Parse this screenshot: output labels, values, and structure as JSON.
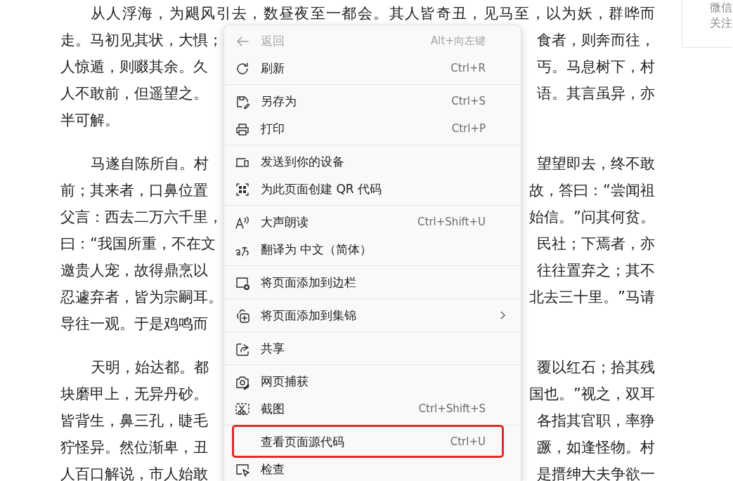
{
  "article": {
    "paragraphs": [
      {
        "lines": [
          {
            "left": "从人浮海，为飓风引去，数昼夜至一都会。其人皆奇丑，见马至，以为妖，群哗而"
          },
          {
            "left": "走。马初见其状，大惧；",
            "right": "食者，则奔而往，"
          },
          {
            "left": "人惊遁，则啜其余。久",
            "right": "丐。马息树下，村"
          },
          {
            "left": "人不敢前，但遥望之。",
            "right": "语。其言虽异，亦"
          },
          {
            "left": "半可解。"
          }
        ]
      },
      {
        "lines": [
          {
            "left": "马遂自陈所自。村",
            "right": "望望即去，终不敢"
          },
          {
            "left": "前；其来者，口鼻位置",
            "right": "故，答曰：“尝闻祖"
          },
          {
            "left": "父言：西去二万六千里，",
            "right": "始信。”问其何贫。"
          },
          {
            "left": "曰：“我国所重，不在文",
            "right": "民社；下焉者，亦"
          },
          {
            "left": "邀贵人宠，故得鼎烹以",
            "right": "往往置弃之；其不"
          },
          {
            "left": "忍遽弃者，皆为宗嗣耳。",
            "right": "北去三十里。”马请"
          },
          {
            "left": "导往一观。于是鸡鸣而"
          }
        ]
      },
      {
        "lines": [
          {
            "left": "天明，始达都。都",
            "right": "覆以红石；拾其残"
          },
          {
            "left": "块磨甲上，无异丹砂。",
            "right": "国也。”视之，双耳"
          },
          {
            "left": "皆背生，鼻三孔，睫毛",
            "right": "各指其官职，率狰"
          },
          {
            "left": "狞怪异。然位渐卑，丑",
            "right": "蹶，如逢怪物。村"
          },
          {
            "left": "人百口解说，市人始敢",
            "right": "是搢绅大夫争欲一"
          }
        ]
      }
    ]
  },
  "side_card": {
    "lines": [
      "微信",
      "关注"
    ]
  },
  "context_menu": {
    "groups": [
      [
        {
          "label": "返回",
          "shortcut": "Alt+向左键",
          "disabled": true
        },
        {
          "label": "刷新",
          "shortcut": "Ctrl+R",
          "disabled": false
        }
      ],
      [
        {
          "label": "另存为",
          "shortcut": "Ctrl+S",
          "disabled": false
        },
        {
          "label": "打印",
          "shortcut": "Ctrl+P",
          "disabled": false
        }
      ],
      [
        {
          "label": "发送到你的设备",
          "disabled": false
        },
        {
          "label": "为此页面创建 QR 代码",
          "disabled": false
        }
      ],
      [
        {
          "label": "大声朗读",
          "shortcut": "Ctrl+Shift+U",
          "disabled": false
        },
        {
          "label": "翻译为 中文（简体）",
          "disabled": false
        }
      ],
      [
        {
          "label": "将页面添加到边栏",
          "disabled": false
        }
      ],
      [
        {
          "label": "将页面添加到集锦",
          "disabled": false,
          "submenu": true
        }
      ],
      [
        {
          "label": "共享",
          "disabled": false
        }
      ],
      [
        {
          "label": "网页捕获",
          "disabled": false
        },
        {
          "label": "截图",
          "shortcut": "Ctrl+Shift+S",
          "disabled": false
        }
      ],
      [
        {
          "label": "查看页面源代码",
          "shortcut": "Ctrl+U",
          "disabled": false,
          "highlighted": true
        },
        {
          "label": "检查",
          "disabled": false
        }
      ]
    ]
  }
}
